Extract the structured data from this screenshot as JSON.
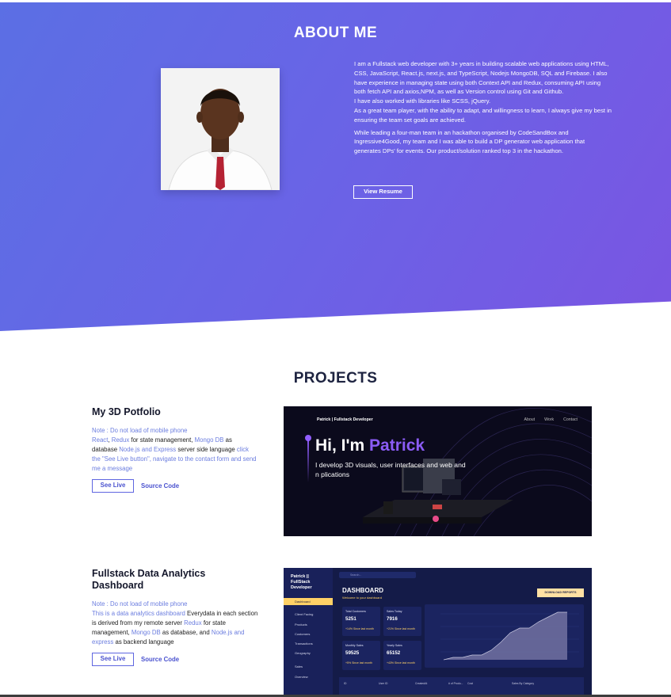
{
  "about": {
    "title": "ABOUT ME",
    "paragraphs": [
      "I am a Fullstack web developer with 3+ years in building scalable web applications using HTML, CSS, JavaScript, React.js, next.js, and TypeScript, Nodejs MongoDB, SQL and Firebase. I also have experience in managing state using both Context API and Redux, consuming API using both fetch API and axios,NPM, as well as Version control using Git and Github.\nI have also worked with libraries like SCSS, jQuery.\nAs a great team player, with the ability to adapt, and willingness to learn, I always give my best in ensuring the team set goals are achieved.",
      "While leading a four-man team in an hackathon organised by CodeSandBox and Ingressive4Good, my team and I was able to build a DP generator web application that generates DPs' for events. Our product/solution ranked top 3 in the hackathon."
    ],
    "resume_button": "View Resume",
    "colors": {
      "gradient_start": "#5b6fe4",
      "gradient_end": "#7a55e2"
    }
  },
  "projects": {
    "title": "PROJECTS",
    "items": [
      {
        "title": "My 3D Potfolio",
        "note": "Note : Do not load of mobile phone",
        "desc": {
          "a": "React",
          "b": ", ",
          "c": "Redux",
          "d": " for state management, ",
          "e": "Mongo DB",
          "f": " as database ",
          "g": "Node.js and Express",
          "h": " server side language ",
          "i": "click the \"See Live button\", navigate to the contact form and send me a message"
        },
        "live": "See Live",
        "source": "Source Code",
        "preview": {
          "brand": "Patrick | Fullstack Developer",
          "nav": [
            "About",
            "Work",
            "Contact"
          ],
          "hi": "Hi, I'm ",
          "name": "Patrick",
          "sub": "I develop 3D visuals, user interfaces and web and n       plications"
        }
      },
      {
        "title": "Fullstack Data Analytics Dashboard",
        "note": "Note : Do not load of mobile phone",
        "desc": {
          "a": "This is a data analytics dashboard",
          "b": " Everydata in each section is derived from my remote server ",
          "c": "Redux",
          "d": " for state management, ",
          "e": "Mongo DB",
          "f": " as database, and ",
          "g": "Node.js and express",
          "h": " as backend language"
        },
        "live": "See Live",
        "source": "Source Code",
        "preview": {
          "brand": "Patrick || FullStack Developer",
          "heading": "DASHBOARD",
          "subheading": "Welcome to your dashboard",
          "download": "DOWNLOAD REPORTS",
          "search": "Search...",
          "menu": [
            "Dashboard",
            "Client Facing",
            "Products",
            "Customers",
            "Transactions",
            "Geography",
            "Sales",
            "Overview"
          ],
          "cards": [
            {
              "label": "Total Customers",
              "value": "5251",
              "pct": "+14%  Since last month"
            },
            {
              "label": "Sales Today",
              "value": "7916",
              "pct": "+21%  Since last month"
            },
            {
              "label": "Monthly Sales",
              "value": "59525",
              "pct": "+5%  Since last month"
            },
            {
              "label": "Yearly Sales",
              "value": "65152",
              "pct": "+43%  Since last month"
            }
          ],
          "table_headers": [
            "ID",
            "User ID",
            "CreatedAt",
            "# of Produ...",
            "Cost"
          ],
          "side_title": "Sales By Category"
        }
      }
    ]
  }
}
